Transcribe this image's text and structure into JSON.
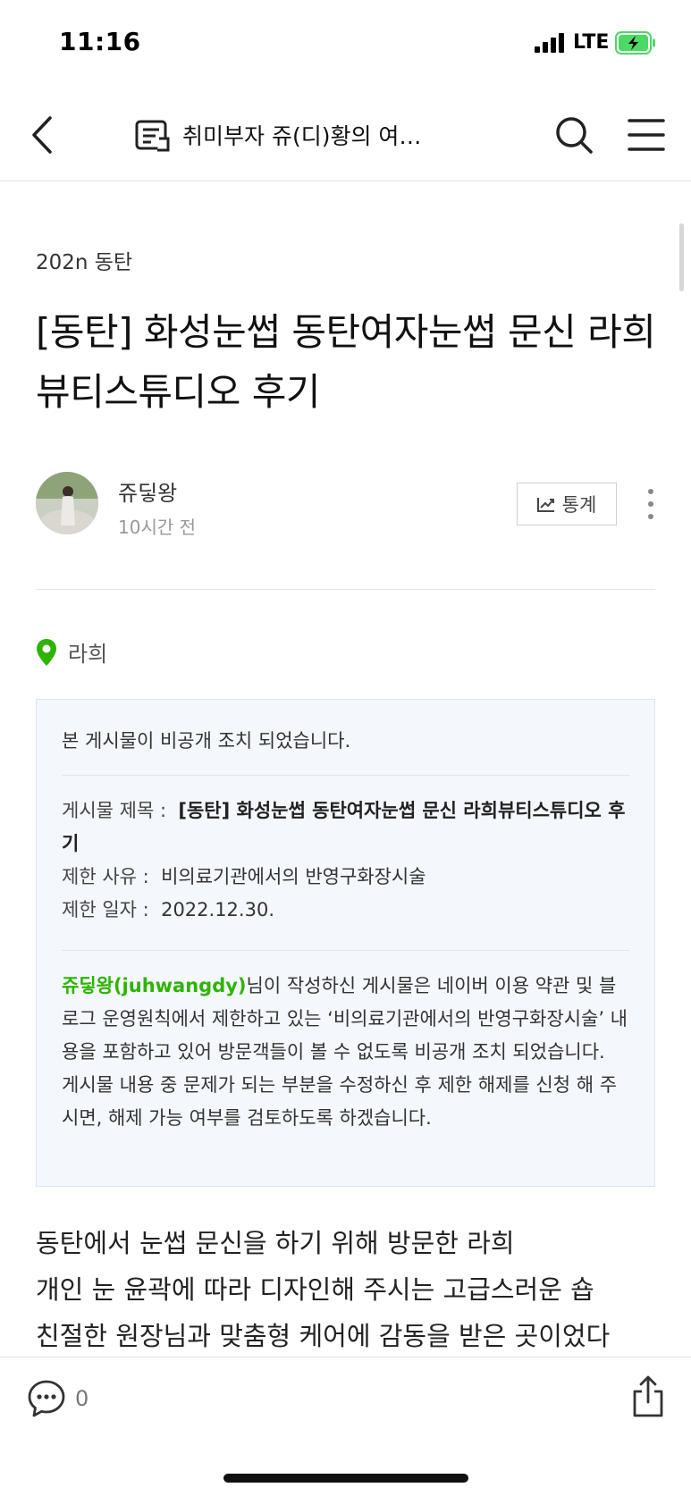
{
  "status_bar": {
    "time": "11:16",
    "network": "LTE"
  },
  "nav": {
    "title": "취미부자 쥬(디)황의 여…",
    "icons": [
      "back-icon",
      "blog-icon",
      "search-icon",
      "menu-icon"
    ]
  },
  "post": {
    "category": "202n 동탄",
    "title": "[동탄] 화성눈썹 동탄여자눈썹 문신 라희뷰티스튜디오 후기",
    "author": "쥬딯왕",
    "time_ago": "10시간 전",
    "stats_label": "통계",
    "location": "라희"
  },
  "notice": {
    "headline": "본 게시물이 비공개 조치 되었습니다.",
    "title_label": "게시물 제목 :",
    "title_value": "[동탄] 화성눈썹 동탄여자눈썹 문신 라희뷰티스튜디오 후기",
    "reason_label": "제한 사유 :",
    "reason_value": "비의료기관에서의 반영구화장시술",
    "date_label": "제한 일자 :",
    "date_value": "2022.12.30.",
    "user_id": "쥬딯왕(juhwangdy)",
    "message_1": "님이 작성하신 게시물은 네이버 이용 약관 및 블로그 운영원칙에서 제한하고 있는 ‘비의료기관에서의 반영구화장시술’ 내용을 포함하고 있어 방문객들이 볼 수 없도록 비공개 조치 되었습니다.",
    "message_2": "게시물 내용 중 문제가 되는 부분을 수정하신 후 제한 해제를 신청 해 주시면, 해제 가능 여부를 검토하도록 하겠습니다."
  },
  "body": {
    "lines": [
      "동탄에서 눈썹 문신을 하기 위해 방문한 라희",
      "개인 눈 윤곽에 따라 디자인해 주시는 고급스러운 숍",
      "친절한 원장님과 맞춤형 케어에 감동을 받은 곳이었다"
    ]
  },
  "bottom_bar": {
    "comment_count": "0"
  },
  "colors": {
    "accent_green": "#2db400",
    "notice_bg": "#f4f7fc",
    "battery_green": "#4cd964"
  }
}
